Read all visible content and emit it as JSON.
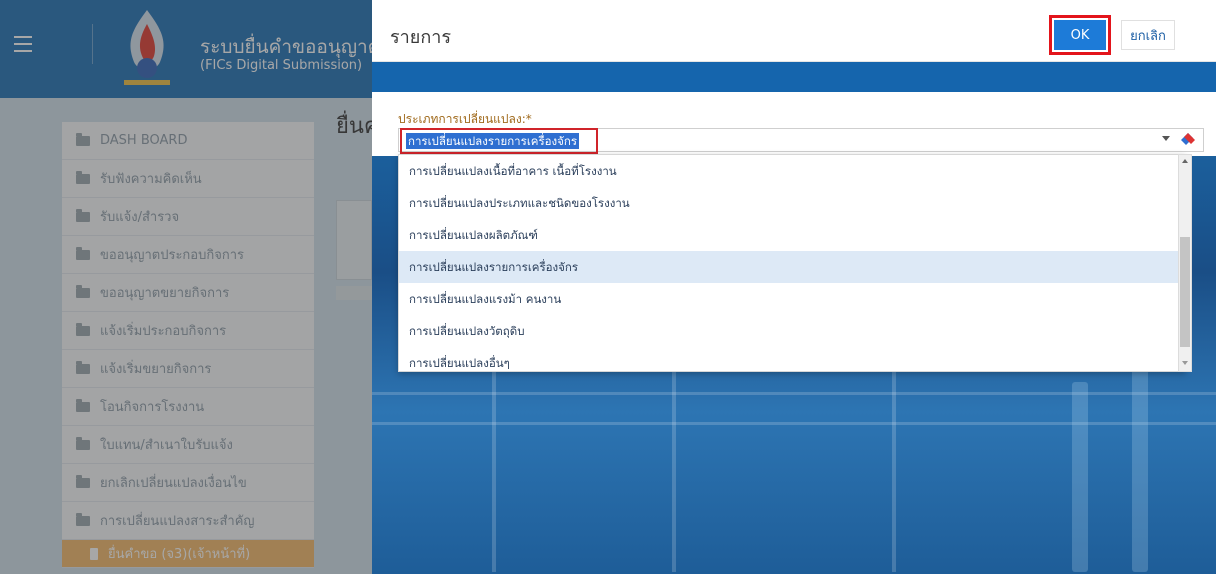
{
  "app": {
    "title": "ระบบยื่นคำขออนุญาต",
    "subtitle": "(FICs Digital Submission)",
    "page_heading": "ยื่นค"
  },
  "sidebar": {
    "items": [
      {
        "label": "DASH BOARD"
      },
      {
        "label": "รับฟังความคิดเห็น"
      },
      {
        "label": "รับแจ้ง/สำรวจ"
      },
      {
        "label": "ขออนุญาตประกอบกิจการ"
      },
      {
        "label": "ขออนุญาตขยายกิจการ"
      },
      {
        "label": "แจ้งเริ่มประกอบกิจการ"
      },
      {
        "label": "แจ้งเริ่มขยายกิจการ"
      },
      {
        "label": "โอนกิจการโรงงาน"
      },
      {
        "label": "ใบแทน/สำเนาใบรับแจ้ง"
      },
      {
        "label": "ยกเลิกเปลี่ยนแปลงเงื่อนไข"
      },
      {
        "label": "การเปลี่ยนแปลงสาระสำคัญ"
      }
    ],
    "active_item": {
      "label": "ยื่นคำขอ (จ3)(เจ้าหน้าที่)"
    }
  },
  "modal": {
    "title": "รายการ",
    "ok_label": "OK",
    "cancel_label": "ยกเลิก",
    "field_label": "ประเภทการเปลี่ยนแปลง:*",
    "selected_value": "การเปลี่ยนแปลงรายการเครื่องจักร",
    "options": [
      {
        "label": "การเปลี่ยนแปลงเนื้อที่อาคาร เนื้อที่โรงงาน"
      },
      {
        "label": "การเปลี่ยนแปลงประเภทและชนิดของโรงงาน"
      },
      {
        "label": "การเปลี่ยนแปลงผลิตภัณฑ์"
      },
      {
        "label": "การเปลี่ยนแปลงรายการเครื่องจักร"
      },
      {
        "label": "การเปลี่ยนแปลงแรงม้า คนงาน"
      },
      {
        "label": "การเปลี่ยนแปลงวัตถุดิบ"
      },
      {
        "label": "การเปลี่ยนแปลงอื่นๆ"
      }
    ]
  },
  "colors": {
    "header_blue": "#1c6fb4",
    "ok_button": "#1d7bd8",
    "highlight_red": "#e3141b",
    "active_menu": "#f4b968"
  }
}
